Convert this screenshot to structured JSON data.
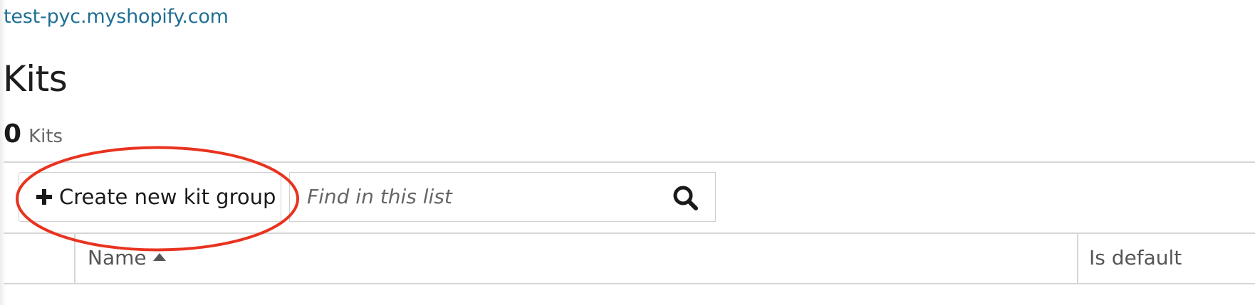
{
  "shop": {
    "domain": "test-pyc.myshopify.com"
  },
  "page": {
    "title": "Kits"
  },
  "summary": {
    "count": "0",
    "label": "Kits"
  },
  "toolbar": {
    "create_label": "Create new kit group",
    "create_icon": "plus-icon",
    "search_placeholder": "Find in this list",
    "search_value": "",
    "search_icon": "magnifier-icon"
  },
  "table": {
    "columns": [
      {
        "label": "Name",
        "sorted": "ascending"
      },
      {
        "label": "Is default"
      }
    ],
    "rows": []
  },
  "colors": {
    "link": "#1f6f95",
    "annotation": "#e8331f",
    "border": "#d6d6d6",
    "text": "#1a1a1a",
    "muted": "#666666"
  }
}
